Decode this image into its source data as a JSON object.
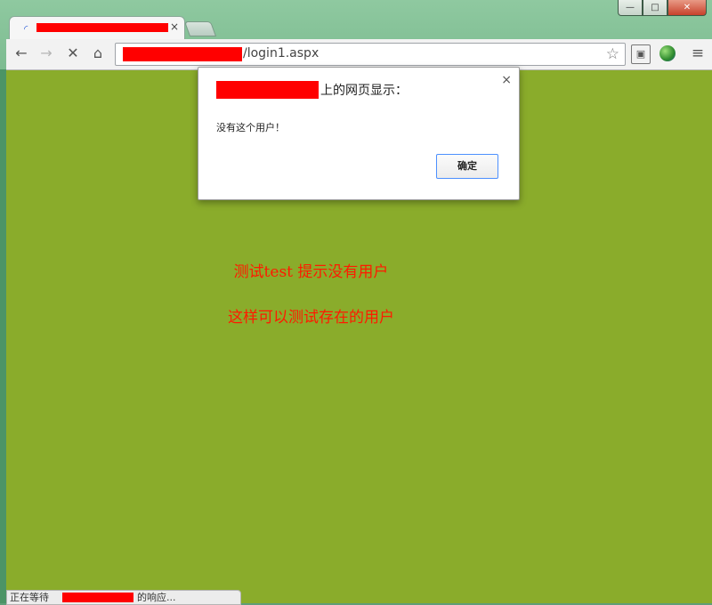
{
  "window": {
    "controls": {
      "minimize": "—",
      "maximize": "□",
      "close": "✕"
    }
  },
  "tab": {
    "title": "",
    "close": "×"
  },
  "toolbar": {
    "back": "←",
    "forward": "→",
    "stop": "✕",
    "home": "⌂",
    "url_path": "/login1.aspx",
    "star": "☆",
    "menu": "≡",
    "ext_icon": "▣"
  },
  "dialog": {
    "title_suffix": "上的网页显示：",
    "close": "×",
    "message": "没有这个用户！",
    "ok_label": "确定"
  },
  "page": {
    "line1": "测试test 提示没有用户",
    "line2": "这样可以测试存在的用户"
  },
  "status": {
    "prefix": "正在等待 ",
    "suffix": " 的响应..."
  },
  "colors": {
    "page_bg": "#8aac2b",
    "text_red": "#ff1a00",
    "redaction": "#ff0000"
  }
}
